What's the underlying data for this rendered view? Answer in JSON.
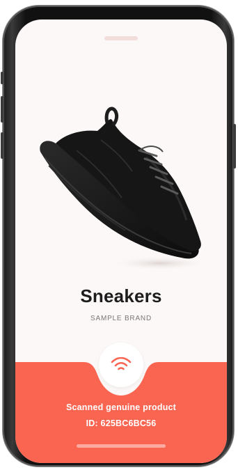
{
  "product": {
    "title": "Sneakers",
    "brand": "SAMPLE BRAND",
    "image_icon": "sneaker-image"
  },
  "scan": {
    "icon": "nfc-signal-icon",
    "status": "Scanned genuine product",
    "id_line": "ID: 625BC6BC56"
  },
  "colors": {
    "accent": "#fa6552",
    "background": "#fbf8f7",
    "title": "#1d1d1d",
    "brand": "#777777"
  }
}
